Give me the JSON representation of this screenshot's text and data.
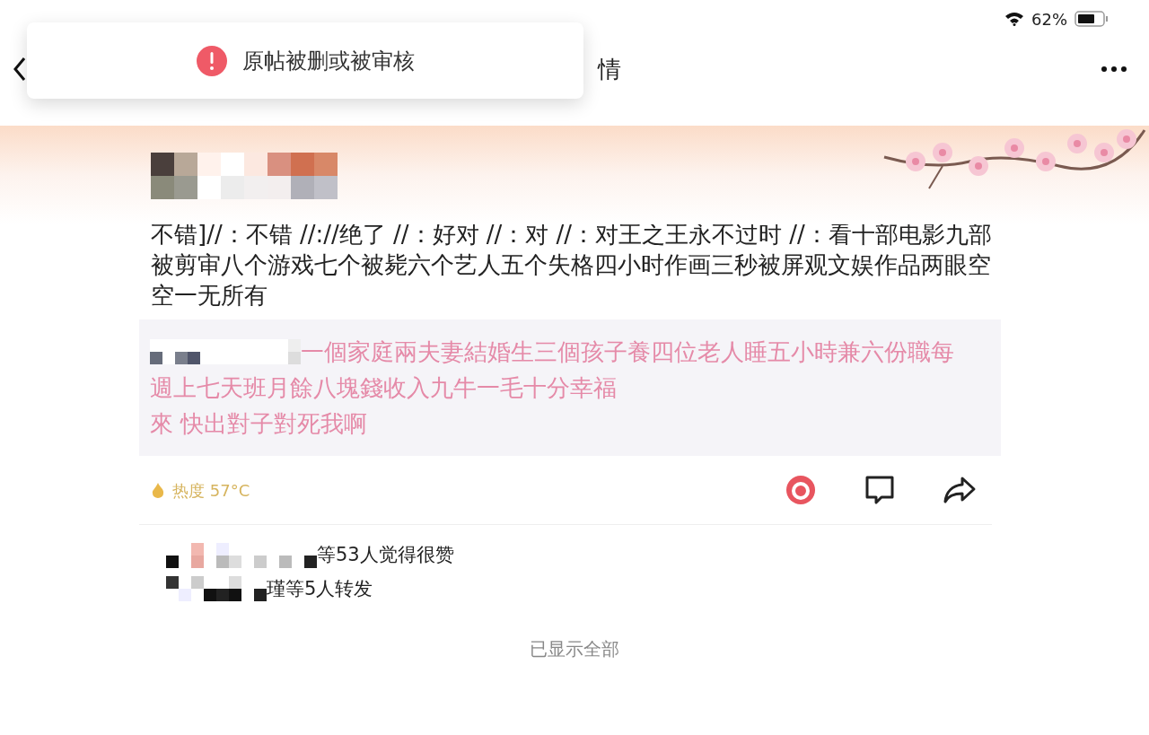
{
  "status_bar": {
    "battery": "62%"
  },
  "header": {
    "title": "情"
  },
  "toast": {
    "message": "原帖被删或被审核"
  },
  "post": {
    "text": "不错]//：不错 //://绝了 //：好对 //：对 //：对王之王永不过时 //：看十部电影九部被剪审八个游戏七个被毙六个艺人五个失格四小时作画三秒被屏观文娱作品两眼空空一无所有",
    "quote": {
      "lines": [
        "一個家庭兩夫妻結婚生三個孩子養四位老人睡五小時兼六份職每",
        "週上七天班月餘八塊錢收入九牛一毛十分幸福",
        "來 快出對子對死我啊"
      ]
    },
    "heat": "热度 57°C"
  },
  "likes": "等53人觉得很赞",
  "reposts": "瑾等5人转发",
  "footer": "已显示全部"
}
